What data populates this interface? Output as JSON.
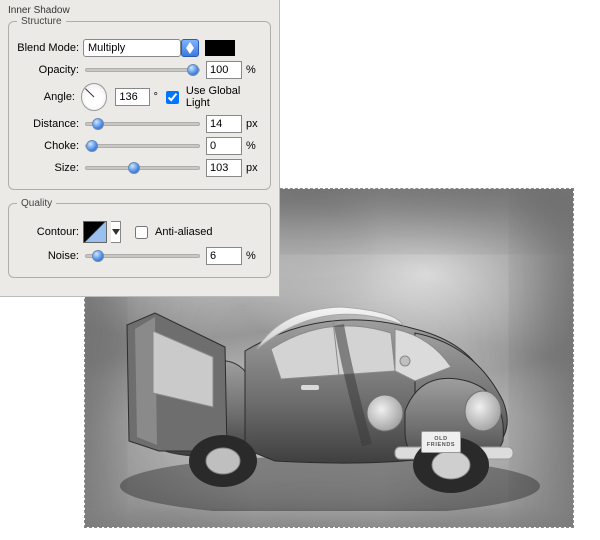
{
  "panel": {
    "title": "Inner Shadow",
    "structure": {
      "legend": "Structure",
      "blendMode": {
        "label": "Blend Mode:",
        "value": "Multiply",
        "color": "#000000"
      },
      "opacity": {
        "label": "Opacity:",
        "value": 100,
        "unit": "%",
        "min": 0,
        "max": 100
      },
      "angle": {
        "label": "Angle:",
        "value": 136,
        "unit": "°",
        "useGlobal": true,
        "useGlobalLabel": "Use Global Light"
      },
      "distance": {
        "label": "Distance:",
        "value": 14,
        "unit": "px",
        "min": 0,
        "max": 250
      },
      "choke": {
        "label": "Choke:",
        "value": 0,
        "unit": "%",
        "min": 0,
        "max": 100
      },
      "size": {
        "label": "Size:",
        "value": 103,
        "unit": "px",
        "min": 0,
        "max": 250
      }
    },
    "quality": {
      "legend": "Quality",
      "contour": {
        "label": "Contour:",
        "antiAliased": false,
        "antiAliasedLabel": "Anti-aliased"
      },
      "noise": {
        "label": "Noise:",
        "value": 6,
        "unit": "%",
        "min": 0,
        "max": 100
      }
    }
  },
  "image": {
    "plate_line1": "OLD",
    "plate_line2": "FRIENDS"
  }
}
